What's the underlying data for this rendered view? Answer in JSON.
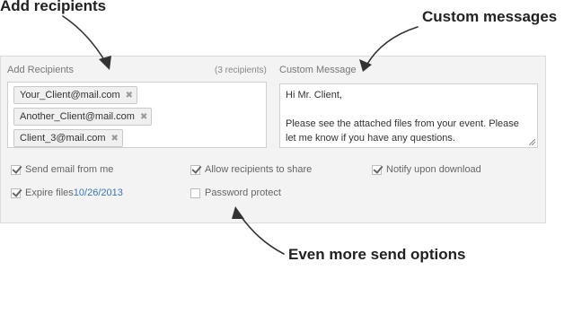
{
  "annotations": {
    "recipients": "Add recipients",
    "messages": "Custom messages",
    "options": "Even more send options"
  },
  "recipients": {
    "label": "Add Recipients",
    "count": "(3 recipients)",
    "chips": [
      {
        "email": "Your_Client@mail.com",
        "remove": "✖"
      },
      {
        "email": "Another_Client@mail.com",
        "remove": "✖"
      },
      {
        "email": "Client_3@mail.com",
        "remove": "✖"
      }
    ]
  },
  "message": {
    "label": "Custom Message",
    "lines": [
      "Hi Mr. Client,",
      "",
      "Please see the attached files from your event. Please",
      "let me know if you have any questions."
    ]
  },
  "options": {
    "send_from_me": {
      "label": "Send email from me",
      "checked": true
    },
    "allow_share": {
      "label": "Allow recipients to share",
      "checked": true
    },
    "notify_download": {
      "label": "Notify upon download",
      "checked": true
    },
    "expire_files": {
      "label": "Expire files",
      "date": "10/26/2013",
      "checked": true
    },
    "password_protect": {
      "label": "Password protect",
      "checked": false
    }
  },
  "colors": {
    "link": "#3a76b6",
    "panel": "#f3f3f3"
  }
}
